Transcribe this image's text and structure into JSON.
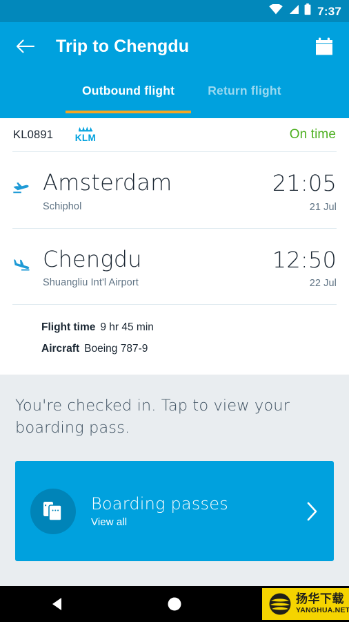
{
  "status_bar": {
    "time": "7:37",
    "icons": [
      "wifi-icon",
      "signal-icon",
      "battery-icon"
    ]
  },
  "app_bar": {
    "back_icon": "arrow-left-icon",
    "title": "Trip to Chengdu",
    "calendar_icon": "calendar-icon",
    "accent_color": "#00a1de",
    "indicator_color": "#f5a623"
  },
  "tabs": [
    {
      "label": "Outbound flight",
      "active": true
    },
    {
      "label": "Return flight",
      "active": false
    }
  ],
  "flight": {
    "number": "KL0891",
    "airline_logo": "klm-logo",
    "airline_name": "KLM",
    "status": "On time",
    "status_color": "#4caf1f",
    "departure": {
      "icon": "flight-takeoff-icon",
      "city": "Amsterdam",
      "airport": "Schiphol",
      "time": "21:05",
      "date": "21 Jul"
    },
    "arrival": {
      "icon": "flight-land-icon",
      "city": "Chengdu",
      "airport": "Shuangliu Int'l Airport",
      "time": "12:50",
      "date": "22 Jul"
    },
    "details": [
      {
        "key": "Flight time",
        "value": "9 hr 45 min"
      },
      {
        "key": "Aircraft",
        "value": "Boeing 787-9"
      }
    ]
  },
  "checkin": {
    "message": "You're checked in. Tap to view your boarding pass."
  },
  "boarding_passes_card": {
    "icon": "boarding-pass-stack-icon",
    "title": "Boarding passes",
    "subtitle": "View all",
    "chevron_icon": "chevron-right-icon",
    "background_color": "#00a1de"
  },
  "nav_bar": {
    "back_icon": "triangle-back-icon",
    "home_icon": "circle-home-icon",
    "watermark": {
      "cn_text": "扬华下载",
      "en_text": "YANGHUA.NET",
      "background_color": "#f5d400"
    }
  }
}
